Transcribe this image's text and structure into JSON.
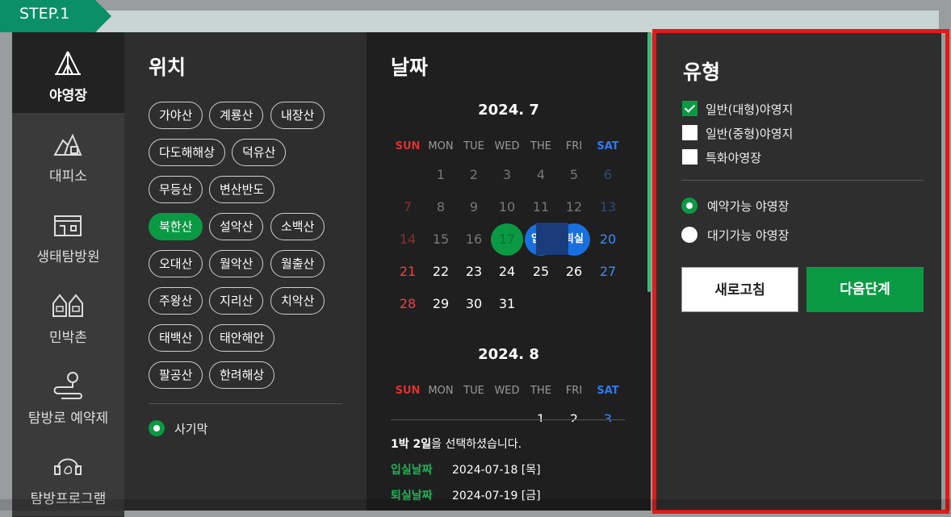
{
  "step": {
    "label": "STEP.1"
  },
  "sidebar": {
    "items": [
      {
        "label": "야영장",
        "icon": "tent-icon"
      },
      {
        "label": "대피소",
        "icon": "shelter-icon"
      },
      {
        "label": "생태탐방원",
        "icon": "eco-center-icon"
      },
      {
        "label": "민박촌",
        "icon": "lodging-icon"
      },
      {
        "label": "탐방로 예약제",
        "icon": "trail-pin-icon"
      },
      {
        "label": "탐방프로그램",
        "icon": "program-icon"
      }
    ]
  },
  "location": {
    "title": "위치",
    "chips": [
      "가야산",
      "계룡산",
      "내장산",
      "다도해해상",
      "덕유산",
      "무등산",
      "변산반도",
      "북한산",
      "설악산",
      "소백산",
      "오대산",
      "월악산",
      "월출산",
      "주왕산",
      "지리산",
      "치악산",
      "태백산",
      "태안해안",
      "팔공산",
      "한려해상"
    ],
    "selected": "북한산",
    "sub_option": "사기막"
  },
  "date": {
    "title": "날짜",
    "weekdays": [
      "SUN",
      "MON",
      "TUE",
      "WED",
      "THE",
      "FRI",
      "SAT"
    ],
    "july": {
      "title": "2024. 7",
      "rows": [
        [
          "",
          "1",
          "2",
          "3",
          "4",
          "5",
          "6"
        ],
        [
          "7",
          "8",
          "9",
          "10",
          "11",
          "12",
          "13"
        ],
        [
          "14",
          "15",
          "16",
          "17",
          "입실",
          "퇴실",
          "20"
        ],
        [
          "21",
          "22",
          "23",
          "24",
          "25",
          "26",
          "27"
        ],
        [
          "28",
          "29",
          "30",
          "31",
          "",
          "",
          ""
        ]
      ]
    },
    "august": {
      "title": "2024. 8",
      "first_row": [
        "",
        "",
        "",
        "",
        "1",
        "2",
        "3"
      ]
    },
    "summary_bold": "1박 2일",
    "summary_rest": "을 선택하셨습니다.",
    "checkin_label": "입실날짜",
    "checkin_value": "2024-07-18 [목]",
    "checkout_label": "퇴실날짜",
    "checkout_value": "2024-07-19 [금]"
  },
  "type": {
    "title": "유형",
    "checkboxes": [
      {
        "label": "일반(대형)야영지",
        "checked": true
      },
      {
        "label": "일반(중형)야영지",
        "checked": false
      },
      {
        "label": "특화야영장",
        "checked": false
      }
    ],
    "radios": [
      {
        "label": "예약가능 야영장",
        "selected": true
      },
      {
        "label": "대기가능 야영장",
        "selected": false
      }
    ],
    "reset_label": "새로고침",
    "next_label": "다음단계"
  },
  "colors": {
    "accent_green": "#0a9a44",
    "highlight_red": "#e01b1b",
    "sat_blue": "#1870e0"
  }
}
